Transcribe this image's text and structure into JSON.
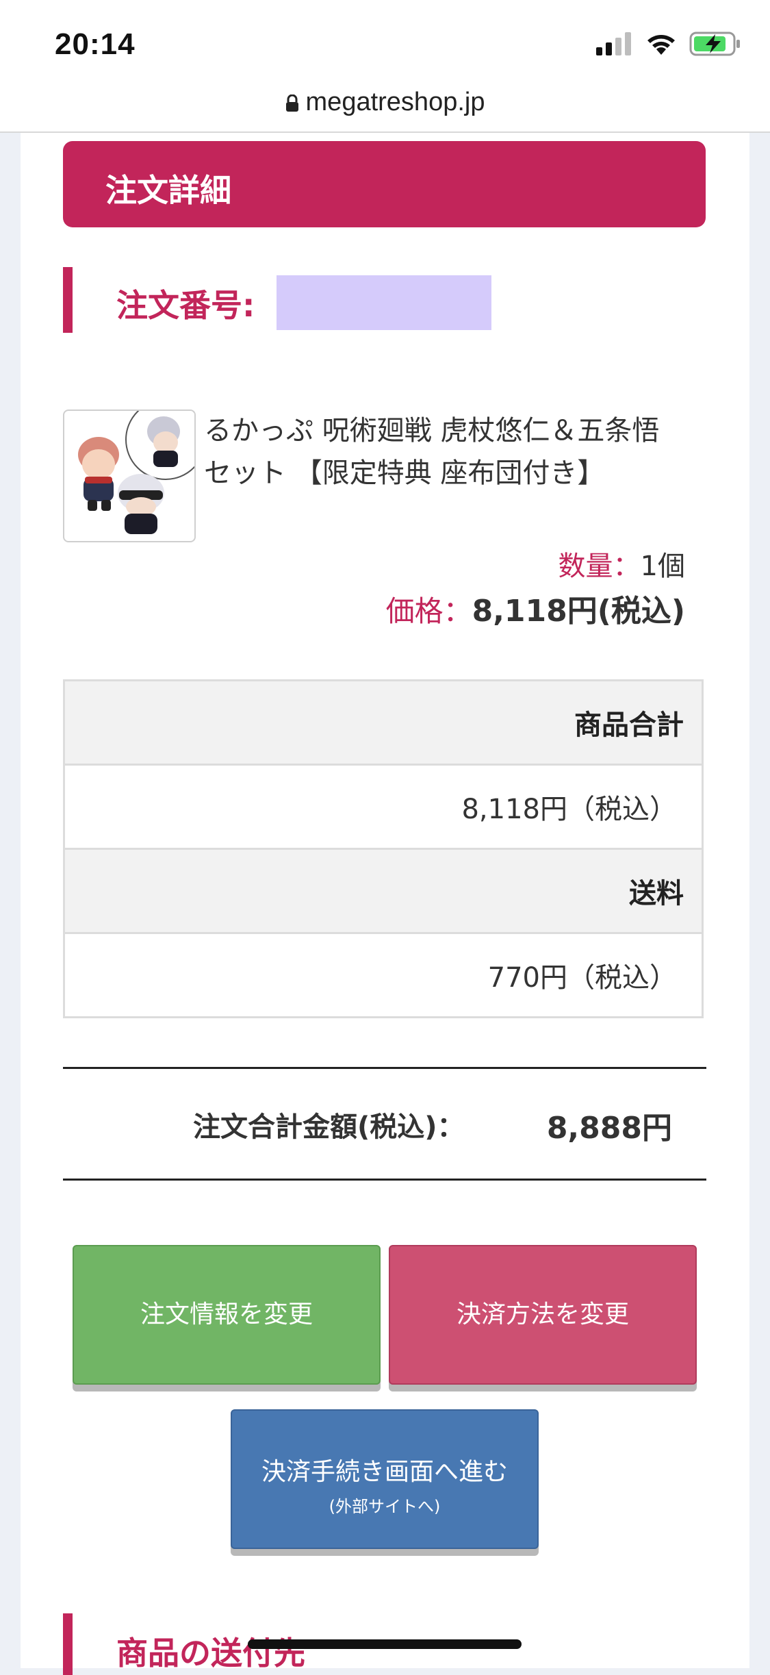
{
  "status_bar": {
    "time": "20:14",
    "icons": [
      "signal-icon",
      "wifi-icon",
      "battery-charging-icon"
    ]
  },
  "browser": {
    "url": "megatreshop.jp"
  },
  "page": {
    "section_title": "注文詳細",
    "order_number_label": "注文番号:",
    "product": {
      "name_line1": "るかっぷ 呪術廻戦 虎杖悠仁＆五条悟",
      "name_line2": "セット 【限定特典 座布団付き】",
      "quantity_label": "数量：",
      "quantity_value": "1個",
      "price_label": "価格：",
      "price_value": "8,118円(税込)"
    },
    "summary": {
      "subtotal_label": "商品合計",
      "subtotal_value": "8,118円（税込）",
      "shipping_label": "送料",
      "shipping_value": "770円（税込）"
    },
    "total": {
      "label": "注文合計金額(税込)：",
      "value": "8,888円"
    },
    "buttons": {
      "change_order_info": "注文情報を変更",
      "change_payment": "決済方法を変更",
      "proceed_main": "決済手続き画面へ進む",
      "proceed_sub": "(外部サイトへ)"
    },
    "shipping_section_title": "商品の送付先"
  },
  "colors": {
    "accent": "#c2255a",
    "green_button": "#71b565",
    "red_button": "#cd5072",
    "blue_button": "#4878b2",
    "redaction": "#d5cbfb"
  }
}
